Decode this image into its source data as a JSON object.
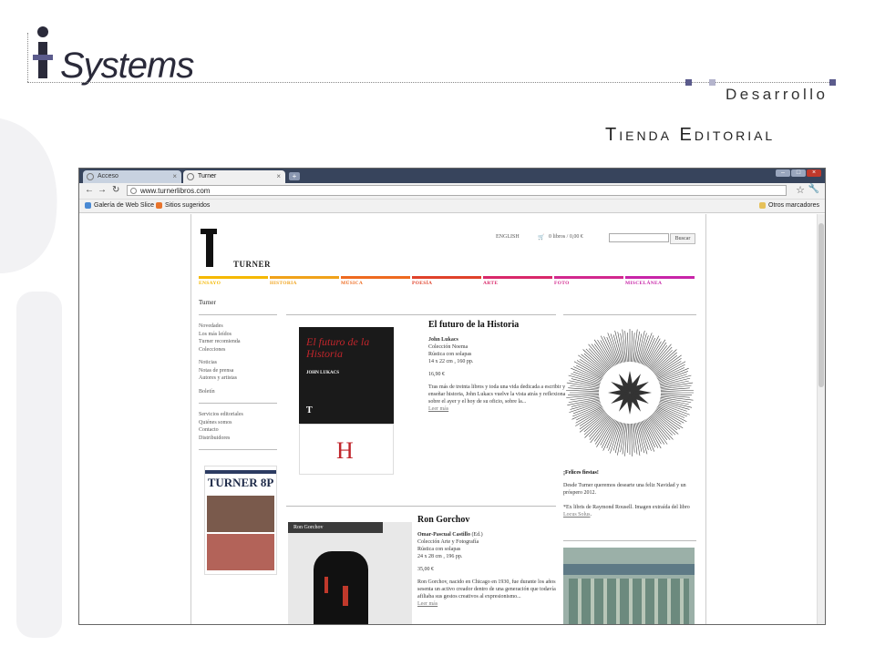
{
  "header": {
    "brand_letter": "i",
    "brand_name": "Systems",
    "subtitle": "Desarrollo",
    "title": "Tienda Editorial"
  },
  "browser": {
    "tabs": [
      {
        "label": "Acceso",
        "active": false
      },
      {
        "label": "Turner",
        "active": true
      }
    ],
    "url": "www.turnerlibros.com",
    "bookmarks": [
      "Galería de Web Slice",
      "Sitios sugeridos"
    ],
    "other_bookmarks": "Otros marcadores"
  },
  "site": {
    "logo_text": "TURNER",
    "lang": "ENGLISH",
    "cart": "0 libros / 0,00 €",
    "search_button": "Buscar",
    "categories": [
      {
        "label": "ENSAYO",
        "color": "#f5b800"
      },
      {
        "label": "HISTORIA",
        "color": "#f0a21a"
      },
      {
        "label": "MÚSICA",
        "color": "#ee6a1f"
      },
      {
        "label": "POESÍA",
        "color": "#e0412a"
      },
      {
        "label": "ARTE",
        "color": "#d9286a"
      },
      {
        "label": "FOTO",
        "color": "#d2288e"
      },
      {
        "label": "MISCELÁNEA",
        "color": "#c824a8"
      }
    ],
    "breadcrumb": "Turner",
    "nav_groups": [
      [
        "Novedades",
        "Los más leídos",
        "Turner recomienda",
        "Colecciones"
      ],
      [
        "Noticias",
        "Notas de prensa",
        "Autores y artistas"
      ],
      [
        "Boletín"
      ],
      [
        "Servicios editoriales",
        "Quiénes somos",
        "Contacto",
        "Distribuidores"
      ]
    ],
    "magazine_title": "TURNER 8P",
    "books": [
      {
        "title": "El futuro de la Historia",
        "author": "John Lukacs",
        "collection": "Colección Noema",
        "binding": "Rústica con solapas",
        "format": "14 x 22 cm , 160 pp.",
        "price": "16,90 €",
        "blurb": "Tras más de treinta libros y toda una vida dedicada a escribir y enseñar historia, John Lukacs vuelve la vista atrás y reflexiona sobre el ayer y el hoy de su oficio, sobre la...",
        "read_more": "Leer más",
        "cover_title": "El futuro de la Historia",
        "cover_author": "JOHN LUKACS",
        "cover_mark": "T",
        "cover_letter": "H"
      },
      {
        "title": "Ron Gorchov",
        "author": "Omar-Pascual Castillo",
        "author_role": "(Ed.)",
        "collection": "Colección Arte y Fotografía",
        "binding": "Rústica con solapas",
        "format": "24 x 28 cm , 196 pp.",
        "price": "35,00 €",
        "blurb": "Ron Gorchov, nacido en Chicago en 1930, fue durante los años sesenta un activo creador dentro de una generación que todavía afiliaba sus gestos creativos al expresionismo...",
        "read_more": "Leer más",
        "cover_band": "Ron Gorchov"
      }
    ],
    "greeting": {
      "title": "¡Felices fiestas!",
      "text": "Desde Turner queremos desearte una feliz Navidad y un próspero 2012.",
      "caption_prefix": "*Ex libris de Raymond Rousell. Imagen extraída del libro",
      "caption_link": "Locus Solus",
      "caption_suffix": "."
    }
  }
}
